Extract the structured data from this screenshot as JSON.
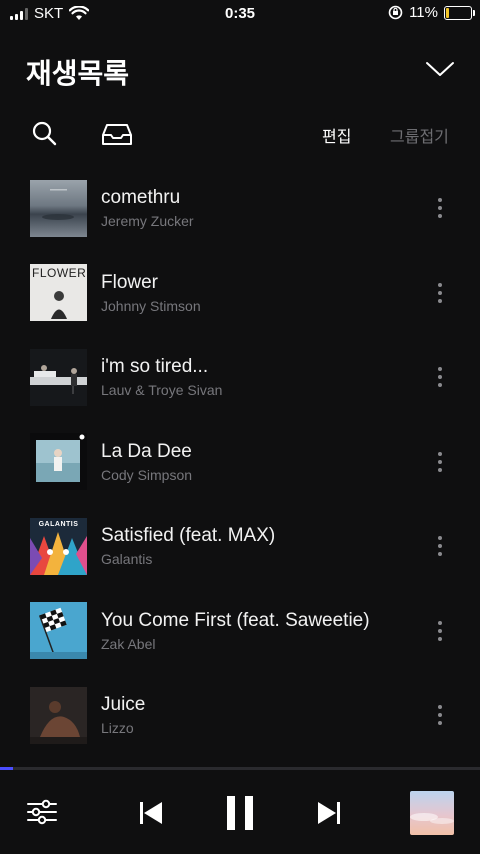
{
  "status_bar": {
    "carrier": "SKT",
    "time": "0:35",
    "battery_percent": "11%",
    "battery_level": 0.11,
    "icons": [
      "signal-icon",
      "wifi-icon",
      "orientation-lock-icon",
      "battery-icon"
    ]
  },
  "header": {
    "title": "재생목록"
  },
  "toolbar": {
    "edit_label": "편집",
    "group_label": "그룹접기"
  },
  "tracks": [
    {
      "title": "comethru",
      "artist": "Jeremy Zucker"
    },
    {
      "title": "Flower",
      "artist": "Johnny Stimson",
      "cover_text": "FLOWER"
    },
    {
      "title": "i'm so tired...",
      "artist": "Lauv & Troye Sivan"
    },
    {
      "title": "La Da Dee",
      "artist": "Cody Simpson"
    },
    {
      "title": "Satisfied (feat. MAX)",
      "artist": "Galantis",
      "cover_text": "GALANTIS"
    },
    {
      "title": "You Come First (feat. Saweetie)",
      "artist": "Zak Abel"
    },
    {
      "title": "Juice",
      "artist": "Lizzo"
    }
  ],
  "player": {
    "progress": 0.027,
    "colors": {
      "accent": "#4a4dff"
    }
  }
}
